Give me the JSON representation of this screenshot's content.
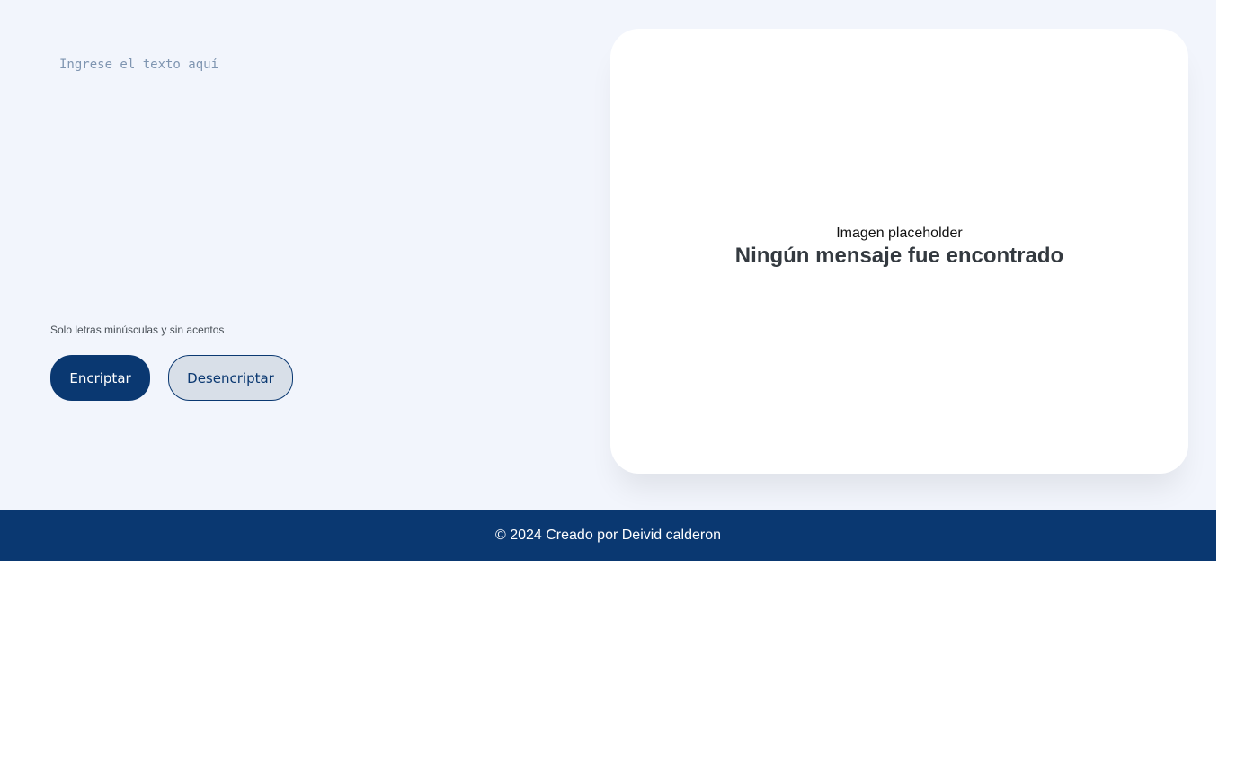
{
  "input": {
    "placeholder": "Ingrese el texto aquí",
    "value": ""
  },
  "hint": {
    "text": "Solo letras minúsculas y sin acentos"
  },
  "buttons": {
    "encrypt_label": "Encriptar",
    "decrypt_label": "Desencriptar"
  },
  "output": {
    "image_placeholder": "Imagen placeholder",
    "empty_title": "Ningún mensaje fue encontrado"
  },
  "footer": {
    "text": "© 2024 Creado por Deivid calderon"
  },
  "colors": {
    "background": "#f2f5fc",
    "primary": "#0a3871",
    "secondary": "#d8dfe8",
    "card": "#ffffff"
  }
}
